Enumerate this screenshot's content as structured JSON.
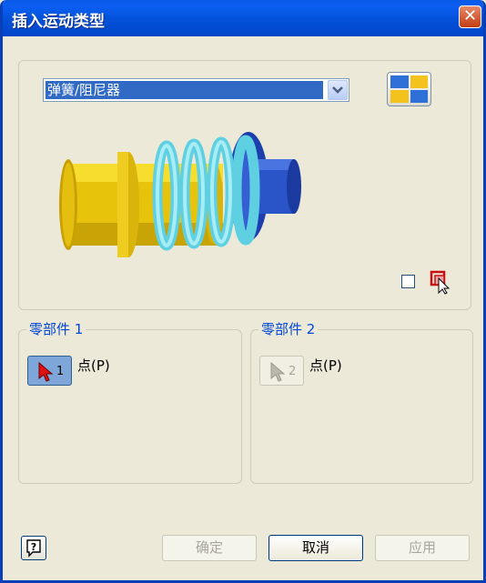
{
  "window": {
    "title": "插入运动类型",
    "close_label": "✕"
  },
  "motion_type": {
    "selected": "弹簧/阻尼器"
  },
  "component1": {
    "legend": "零部件 1",
    "button_number": "1",
    "point_label": "点(P)",
    "active": true
  },
  "component2": {
    "legend": "零部件 2",
    "button_number": "2",
    "point_label": "点(P)",
    "active": false
  },
  "flip_checkbox": {
    "checked": false
  },
  "buttons": {
    "ok": "确定",
    "cancel": "取消",
    "apply": "应用"
  },
  "icons": {
    "title": "close-icon",
    "layout": "layout-grid-icon",
    "dropdown": "chevron-down-icon",
    "pick": "pick-cursor-icon",
    "help": "help-icon",
    "select": "arrow-cursor-icon",
    "illustration": "spring-damper-icon"
  },
  "colors": {
    "titlebar": "#0451d8",
    "dialog": "#ece9d8",
    "accent": "#0046d5",
    "selection": "#316ac5"
  }
}
